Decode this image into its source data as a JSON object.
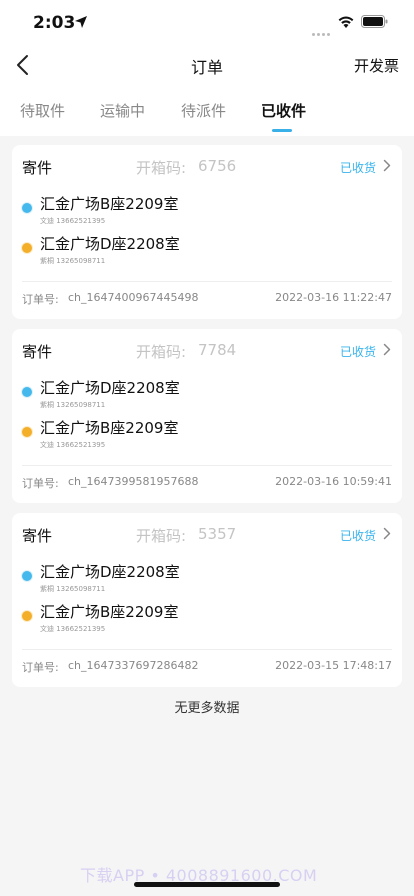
{
  "status_bar": {
    "time": "2:03"
  },
  "nav": {
    "title": "订单",
    "invoice_label": "开发票"
  },
  "tabs": [
    {
      "label": "待取件"
    },
    {
      "label": "运输中"
    },
    {
      "label": "待派件"
    },
    {
      "label": "已收件"
    }
  ],
  "orders": [
    {
      "type": "寄件",
      "code_label": "开箱码:",
      "code": "6756",
      "status": "已收货",
      "from": {
        "name": "汇金广场B座2209室",
        "contact": "文迪 13662521395"
      },
      "to": {
        "name": "汇金广场D座2208室",
        "contact": "紫桐 13265098711"
      },
      "order_label": "订单号:",
      "order_no": "ch_1647400967445498",
      "time": "2022-03-16 11:22:47"
    },
    {
      "type": "寄件",
      "code_label": "开箱码:",
      "code": "7784",
      "status": "已收货",
      "from": {
        "name": "汇金广场D座2208室",
        "contact": "紫桐 13265098711"
      },
      "to": {
        "name": "汇金广场B座2209室",
        "contact": "文迪 13662521395"
      },
      "order_label": "订单号:",
      "order_no": "ch_1647399581957688",
      "time": "2022-03-16 10:59:41"
    },
    {
      "type": "寄件",
      "code_label": "开箱码:",
      "code": "5357",
      "status": "已收货",
      "from": {
        "name": "汇金广场D座2208室",
        "contact": "紫桐 13265098711"
      },
      "to": {
        "name": "汇金广场B座2209室",
        "contact": "文迪 13662521395"
      },
      "order_label": "订单号:",
      "order_no": "ch_1647337697286482",
      "time": "2022-03-15 17:48:17"
    }
  ],
  "footer": {
    "no_more": "无更多数据"
  },
  "watermark": "下载APP • 4008891600.COM",
  "colors": {
    "accent": "#38b4ec",
    "from_dot": "#45b8ec",
    "to_dot": "#f3ae2a"
  }
}
